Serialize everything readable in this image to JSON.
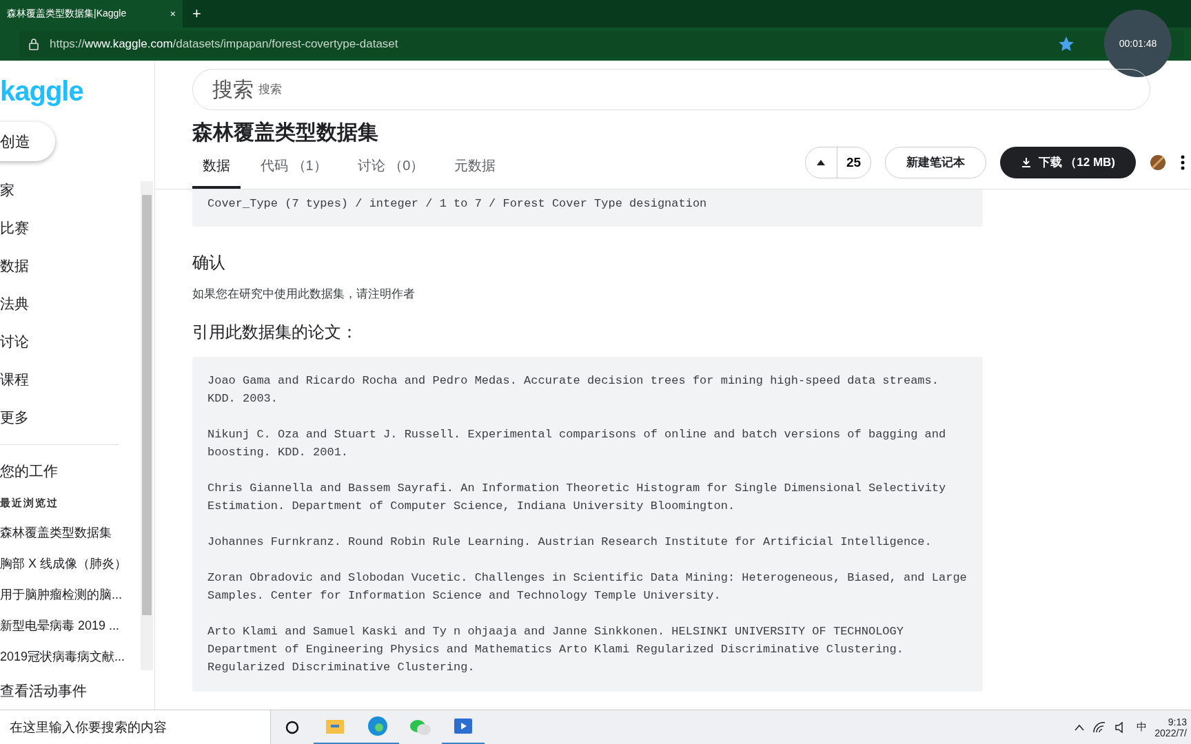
{
  "browser": {
    "tab_title": "森林覆盖类型数据集|Kaggle",
    "tab_close": "×",
    "new_tab": "+",
    "url_prefix": "https://",
    "url_host": "www.kaggle.com",
    "url_path": "/datasets/impapan/forest-covertype-dataset",
    "favorite": true
  },
  "recorder": {
    "time": "00:01:48"
  },
  "sidebar": {
    "logo": "kaggle",
    "create": "创造",
    "items": [
      {
        "label": "家"
      },
      {
        "label": "比赛"
      },
      {
        "label": "数据"
      },
      {
        "label": "法典"
      },
      {
        "label": "讨论"
      },
      {
        "label": "课程"
      },
      {
        "label": "更多"
      }
    ],
    "your_work": "您的工作",
    "recent_title": "最近浏览过",
    "recent": [
      "森林覆盖类型数据集",
      "胸部 X 线成像（肺炎）",
      "用于脑肿瘤检测的脑...",
      "新型电晕病毒 2019 ...",
      "2019冠状病毒病文献..."
    ],
    "events": "查看活动事件"
  },
  "search": {
    "placeholder": "搜索",
    "label": "搜索"
  },
  "dataset": {
    "title": "森林覆盖类型数据集",
    "tabs": [
      {
        "label": "数据",
        "selected": true
      },
      {
        "label": "代码 （1）",
        "selected": false
      },
      {
        "label": "讨论 （0）",
        "selected": false
      },
      {
        "label": "元数据",
        "selected": false
      }
    ],
    "votes": "25",
    "new_notebook": "新建笔记本",
    "download": "下载 （12 MB)"
  },
  "column_line": "Cover_Type (7 types) / integer / 1 to 7 / Forest Cover Type designation",
  "acknowledgement": {
    "heading": "确认",
    "text": "如果您在研究中使用此数据集，请注明作者"
  },
  "papers": {
    "heading": "引用此数据集的论文：",
    "items": [
      "Joao Gama and Ricardo Rocha and Pedro Medas. Accurate decision trees for mining high-speed data streams. KDD. 2003.",
      "Nikunj C. Oza and Stuart J. Russell. Experimental comparisons of online and batch versions of bagging and boosting. KDD. 2001.",
      "Chris Giannella and Bassem Sayrafi. An Information Theoretic Histogram for Single Dimensional Selectivity Estimation. Department of Computer Science, Indiana University Bloomington.",
      "Johannes Furnkranz. Round Robin Rule Learning. Austrian Research Institute for Artificial Intelligence.",
      "Zoran Obradovic and Slobodan Vucetic. Challenges in Scientific Data Mining: Heterogeneous, Biased, and Large Samples. Center for Information Science and Technology Temple University.",
      "Arto Klami and Samuel Kaski and Ty n ohjaaja and Janne Sinkkonen. HELSINKI UNIVERSITY OF TECHNOLOGY Department of Engineering Physics and Mathematics Arto Klami Regularized Discriminative Clustering. Regularized Discriminative Clustering."
    ]
  },
  "taskbar": {
    "search": "在这里输入你要搜索的内容",
    "ime": "中",
    "time": "9:13",
    "date": "2022/7/"
  }
}
